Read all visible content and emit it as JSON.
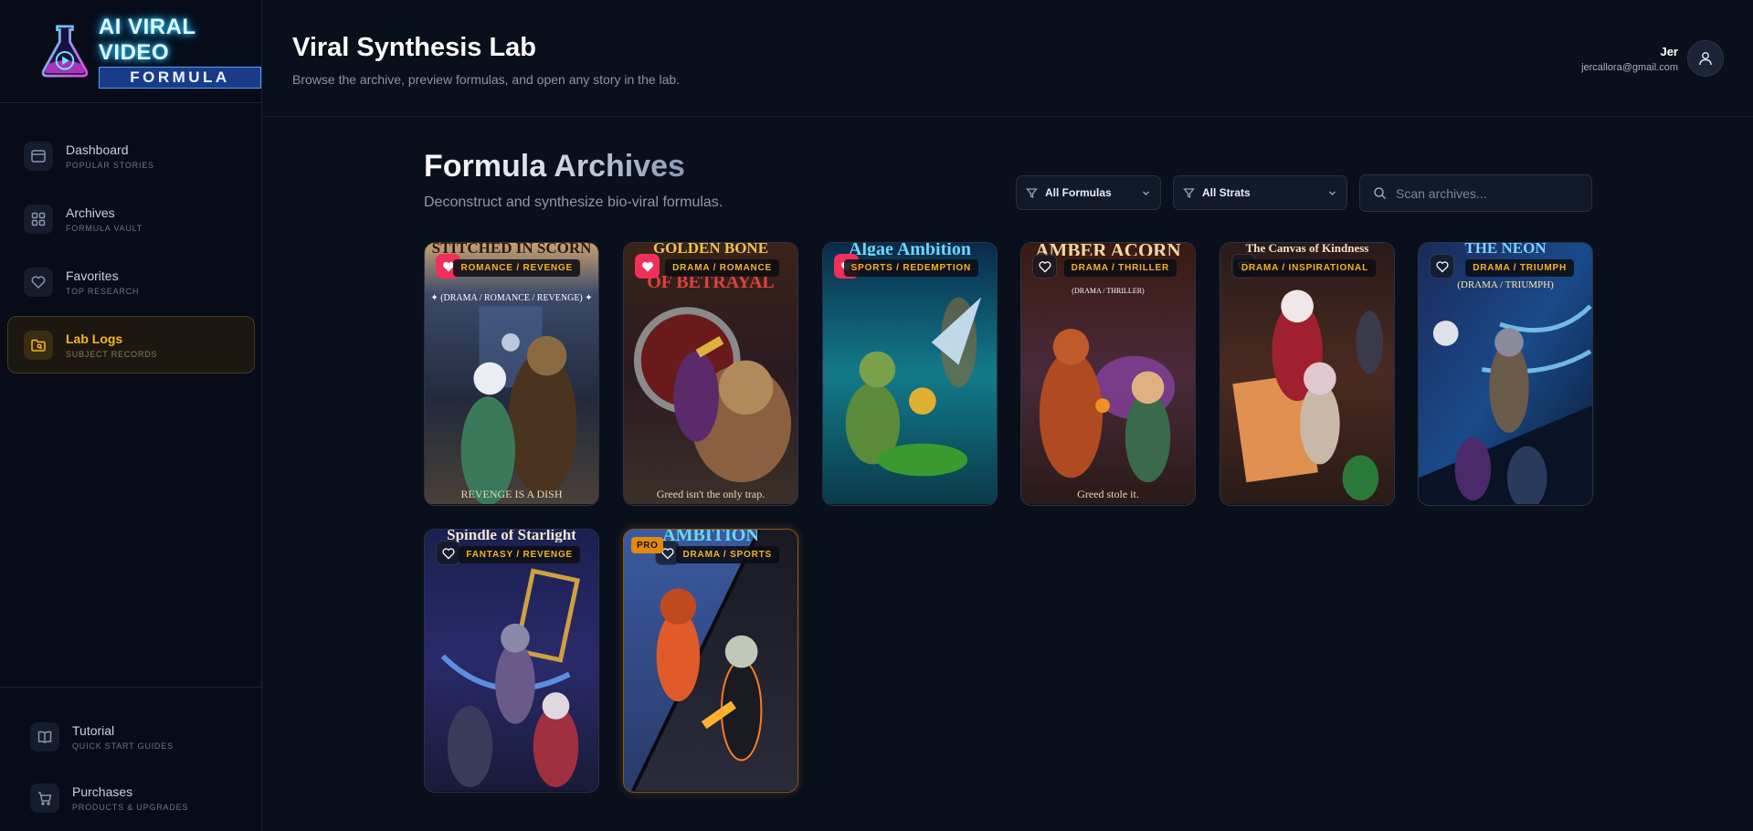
{
  "logo": {
    "line1": "AI VIRAL VIDEO",
    "line2": "FORMULA"
  },
  "sidebar": {
    "items": [
      {
        "label": "Dashboard",
        "sub": "POPULAR STORIES",
        "icon": "browser-window-icon"
      },
      {
        "label": "Archives",
        "sub": "FORMULA VAULT",
        "icon": "grid-icon"
      },
      {
        "label": "Favorites",
        "sub": "TOP RESEARCH",
        "icon": "heart-icon"
      },
      {
        "label": "Lab Logs",
        "sub": "SUBJECT RECORDS",
        "icon": "folder-icon",
        "active": true
      }
    ],
    "bottom": [
      {
        "label": "Tutorial",
        "sub": "QUICK START GUIDES",
        "icon": "book-icon"
      },
      {
        "label": "Purchases",
        "sub": "PRODUCTS & UPGRADES",
        "icon": "cart-icon"
      }
    ]
  },
  "header": {
    "title": "Viral Synthesis Lab",
    "subtitle": "Browse the archive, preview formulas, and open any story in the lab."
  },
  "user": {
    "name": "Jer",
    "email": "jercallora@gmail.com"
  },
  "main": {
    "title": "Formula Archives",
    "subtitle": "Deconstruct and synthesize bio-viral formulas.",
    "filters": {
      "formulas": "All Formulas",
      "strats": "All Strats"
    },
    "search_placeholder": "Scan archives..."
  },
  "cards": [
    {
      "tag": "ROMANCE / REVENGE",
      "favorited": true,
      "top_text": "STITCHED IN SCORN",
      "subtitle": "✦ (DRAMA / ROMANCE / REVENGE) ✦",
      "caption": "REVENGE IS A DISH",
      "palette": [
        "#3a4a6a",
        "#1c2233",
        "#6b5a3a"
      ]
    },
    {
      "tag": "DRAMA / ROMANCE",
      "favorited": true,
      "top_text": "GOLDEN BONE",
      "subtitle": "OF BETRAYAL",
      "caption": "Greed isn't the only trap.",
      "palette": [
        "#2a1a20",
        "#6a1a1a",
        "#c89a3a"
      ]
    },
    {
      "tag": "SPORTS / REDEMPTION",
      "favorited": true,
      "top_text": "Algae Ambition",
      "subtitle": "",
      "caption": "",
      "palette": [
        "#0a3a5a",
        "#1a7a8a",
        "#3ac0c0"
      ]
    },
    {
      "tag": "DRAMA / THRILLER",
      "favorited": false,
      "top_text": "AMBER ACORN",
      "subtitle": "(DRAMA / THRILLER)",
      "caption": "Greed stole it.",
      "palette": [
        "#3a2010",
        "#7a3a8a",
        "#c88a3a"
      ]
    },
    {
      "tag": "DRAMA / INSPIRATIONAL",
      "favorited": false,
      "top_text": "The Canvas of Kindness",
      "subtitle": "",
      "caption": "",
      "palette": [
        "#3a2018",
        "#8a2a2a",
        "#d89a5a"
      ]
    },
    {
      "tag": "DRAMA / TRIUMPH",
      "favorited": false,
      "top_text": "THE NEON",
      "subtitle": "(DRAMA / TRIUMPH)",
      "caption": "",
      "palette": [
        "#1a2a5a",
        "#2a6ab0",
        "#7ad0ff"
      ]
    },
    {
      "tag": "FANTASY / REVENGE",
      "favorited": false,
      "top_text": "Spindle of Starlight",
      "subtitle": "",
      "caption": "",
      "palette": [
        "#1a2050",
        "#4a3aa0",
        "#8ab0ff"
      ]
    },
    {
      "tag": "DRAMA / SPORTS",
      "favorited": false,
      "pro": true,
      "pro_label": "PRO",
      "top_text": "AMBITION",
      "subtitle": "",
      "caption": "",
      "palette": [
        "#2a3a6a",
        "#4a5a9a",
        "#e07a2a"
      ]
    }
  ],
  "colors": {
    "accent": "#f6b824",
    "fav_on": "#f0305a",
    "background": "#0a0f1c"
  }
}
